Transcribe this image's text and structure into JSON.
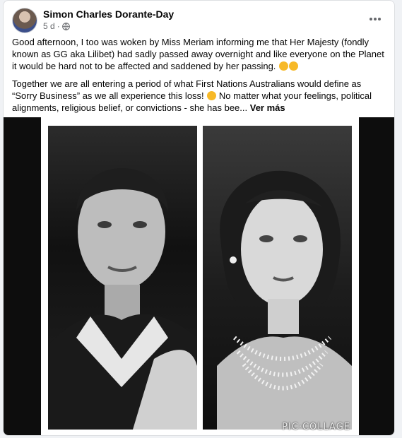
{
  "post": {
    "author": "Simon Charles Dorante-Day",
    "time": "5 d",
    "separator": "·",
    "paragraph1": "Good afternoon, I too was woken by Miss Meriam informing me that Her Majesty (fondly known as GG aka Lilibet) had sadly passed away overnight and like everyone on the Planet it would be hard not to be affected and saddened by her passing.",
    "paragraph2_a": "Together we are all entering a period of what First Nations Australians would define as “Sorry Business” as we all experience this loss!",
    "paragraph2_b": "No matter what your feelings, political alignments, religious belief, or convictions - she has bee...",
    "see_more": "Ver más"
  },
  "media": {
    "watermark": "PIC·COLLAGE"
  },
  "icons": {
    "globe": "globe-icon",
    "more": "more-options-icon",
    "emoji": "sad-face-emoji"
  }
}
